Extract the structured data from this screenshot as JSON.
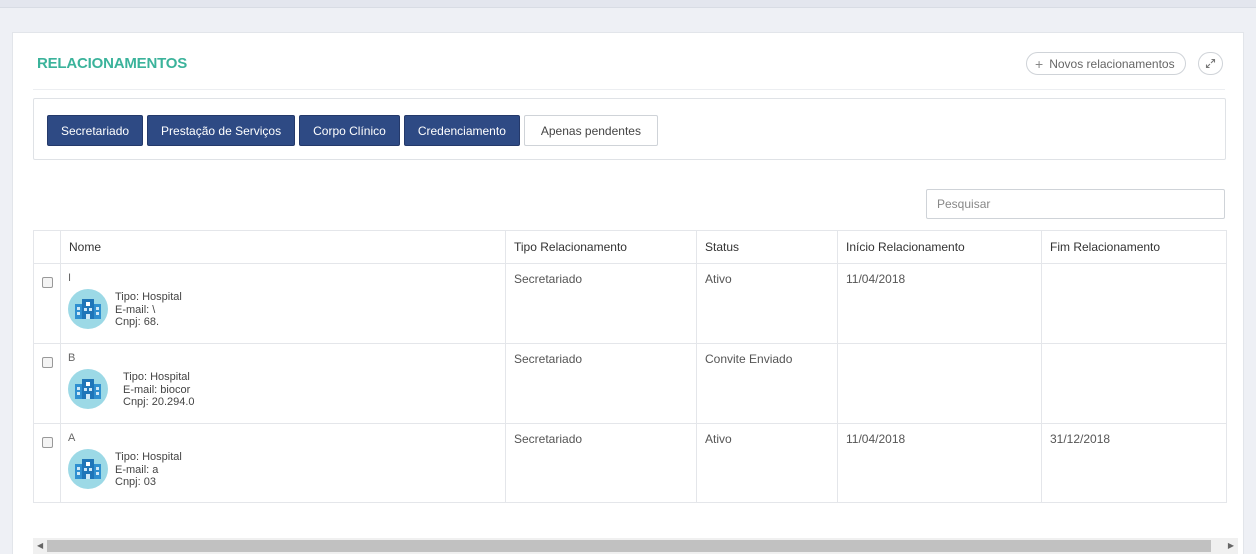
{
  "panel": {
    "title": "RELACIONAMENTOS",
    "new_button_label": "Novos relacionamentos",
    "new_button_icon": "plus-icon",
    "expand_icon": "expand-icon"
  },
  "filters": {
    "buttons": [
      "Secretariado",
      "Prestação de Serviços",
      "Corpo Clínico",
      "Credenciamento"
    ],
    "pending_label": "Apenas pendentes"
  },
  "search": {
    "placeholder": "Pesquisar"
  },
  "table": {
    "headers": [
      "Nome",
      "Tipo Relacionamento",
      "Status",
      "Início Relacionamento",
      "Fim Relacionamento"
    ],
    "rows": [
      {
        "initial": "I",
        "tipo": "Tipo: Hospital",
        "email": "E-mail: \\",
        "cnpj": "Cnpj: 68.",
        "tipo_relacionamento": "Secretariado",
        "status": "Ativo",
        "inicio": "11/04/2018",
        "fim": ""
      },
      {
        "initial": "B",
        "tipo": "Tipo: Hospital",
        "email": "E-mail: biocor",
        "cnpj": "Cnpj: 20.294.0",
        "tipo_relacionamento": "Secretariado",
        "status": "Convite Enviado",
        "inicio": "",
        "fim": ""
      },
      {
        "initial": "A",
        "tipo": "Tipo: Hospital",
        "email": "E-mail: a",
        "cnpj": "Cnpj: 03",
        "tipo_relacionamento": "Secretariado",
        "status": "Ativo",
        "inicio": "11/04/2018",
        "fim": "31/12/2018"
      }
    ]
  },
  "colors": {
    "accent": "#3bb39b",
    "button_active": "#2e4a84",
    "avatar_bg": "#9cd9e6"
  }
}
